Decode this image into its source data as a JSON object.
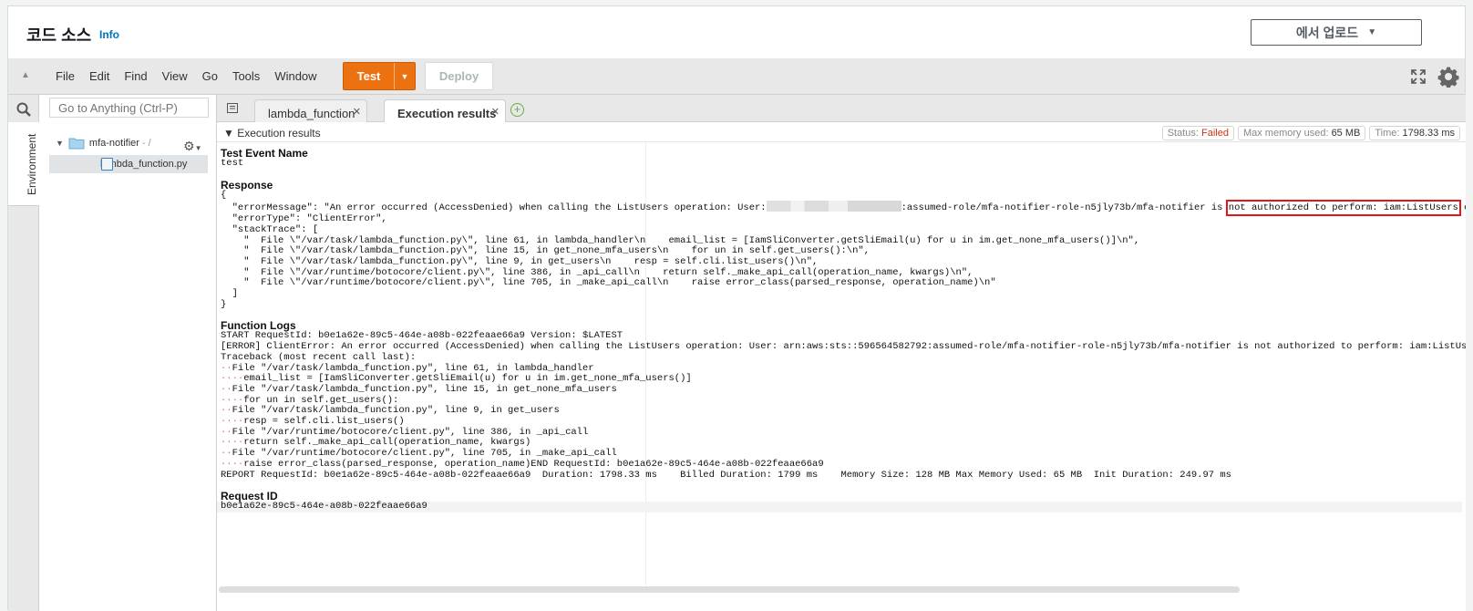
{
  "header": {
    "title": "코드 소스",
    "info_link": "Info",
    "upload_button": "에서 업로드"
  },
  "menubar": {
    "items": [
      "File",
      "Edit",
      "Find",
      "View",
      "Go",
      "Tools",
      "Window"
    ],
    "test_button": "Test",
    "deploy_button": "Deploy"
  },
  "rail": {
    "environment_tab": "Environment"
  },
  "file_tree": {
    "search_placeholder": "Go to Anything (Ctrl-P)",
    "folder_name": "mfa-notifier",
    "folder_path": "- /",
    "file_name": "lambda_function.py"
  },
  "tabs": [
    {
      "label": "lambda_function"
    },
    {
      "label": "Execution results"
    }
  ],
  "results": {
    "section_label": "Execution results",
    "status_label": "Status:",
    "status_value": "Failed",
    "memory_label": "Max memory used:",
    "memory_value": "65 MB",
    "time_label": "Time:",
    "time_value": "1798.33 ms",
    "test_event_heading": "Test Event Name",
    "test_event_value": "test",
    "response_heading": "Response",
    "response_open": "{",
    "response_error_message_prefix": "  \"errorMessage\": \"An error occurred (AccessDenied) when calling the ListUsers operation: User:",
    "response_error_message_mid": ":assumed-role/mfa-notifier-role-n5jly73b/mfa-notifier is ",
    "response_error_message_highlight": "not authorized to perform: iam:ListUsers",
    "response_error_message_suffix": " on resource",
    "response_lines": [
      "  \"errorType\": \"ClientError\",",
      "  \"stackTrace\": [",
      "    \"  File \\\"/var/task/lambda_function.py\\\", line 61, in lambda_handler\\n    email_list = [IamSliConverter.getSliEmail(u) for u in im.get_none_mfa_users()]\\n\",",
      "    \"  File \\\"/var/task/lambda_function.py\\\", line 15, in get_none_mfa_users\\n    for un in self.get_users():\\n\",",
      "    \"  File \\\"/var/task/lambda_function.py\\\", line 9, in get_users\\n    resp = self.cli.list_users()\\n\",",
      "    \"  File \\\"/var/runtime/botocore/client.py\\\", line 386, in _api_call\\n    return self._make_api_call(operation_name, kwargs)\\n\",",
      "    \"  File \\\"/var/runtime/botocore/client.py\\\", line 705, in _make_api_call\\n    raise error_class(parsed_response, operation_name)\\n\"",
      "  ]",
      "}"
    ],
    "function_logs_heading": "Function Logs",
    "log_lines_plain_top": [
      "START RequestId: b0e1a62e-89c5-464e-a08b-022feaae66a9 Version: $LATEST",
      "[ERROR] ClientError: An error occurred (AccessDenied) when calling the ListUsers operation: User: arn:aws:sts::596564582792:assumed-role/mfa-notifier-role-n5jly73b/mfa-notifier is not authorized to perform: iam:ListUsers on resource",
      "Traceback (most recent call last):"
    ],
    "log_lines_indented": [
      {
        "dots": "··",
        "text": "File \"/var/task/lambda_function.py\", line 61, in lambda_handler"
      },
      {
        "dots": "····",
        "text": "email_list = [IamSliConverter.getSliEmail(u) for u in im.get_none_mfa_users()]"
      },
      {
        "dots": "··",
        "text": "File \"/var/task/lambda_function.py\", line 15, in get_none_mfa_users"
      },
      {
        "dots": "····",
        "text": "for un in self.get_users():"
      },
      {
        "dots": "··",
        "text": "File \"/var/task/lambda_function.py\", line 9, in get_users"
      },
      {
        "dots": "····",
        "text": "resp = self.cli.list_users()"
      },
      {
        "dots": "··",
        "text": "File \"/var/runtime/botocore/client.py\", line 386, in _api_call"
      },
      {
        "dots": "····",
        "text": "return self._make_api_call(operation_name, kwargs)"
      },
      {
        "dots": "··",
        "text": "File \"/var/runtime/botocore/client.py\", line 705, in _make_api_call"
      },
      {
        "dots": "····",
        "text": "raise error_class(parsed_response, operation_name)END RequestId: b0e1a62e-89c5-464e-a08b-022feaae66a9"
      }
    ],
    "report_line": "REPORT RequestId: b0e1a62e-89c5-464e-a08b-022feaae66a9  Duration: 1798.33 ms    Billed Duration: 1799 ms    Memory Size: 128 MB Max Memory Used: 65 MB  Init Duration: 249.97 ms",
    "request_id_heading": "Request ID",
    "request_id_value": "b0e1a62e-89c5-464e-a08b-022feaae66a9"
  },
  "colors": {
    "accent_orange": "#ec7211",
    "failed_red": "#d13212",
    "link_blue": "#0073bb",
    "highlight_box": "#e0161b"
  }
}
